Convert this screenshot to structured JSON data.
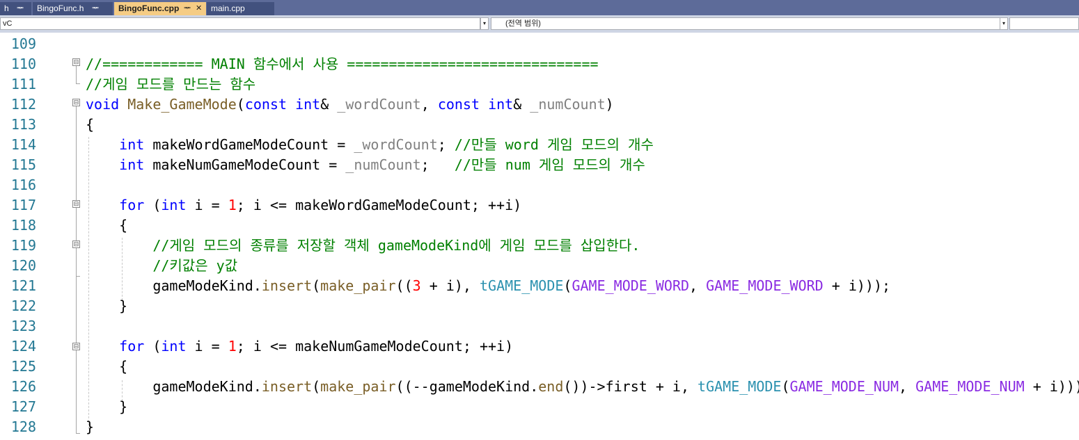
{
  "tabs": [
    {
      "label": "h",
      "pin": "ᆓ"
    },
    {
      "label": "BingoFunc.h",
      "pin": "ᆓ"
    },
    {
      "label": "BingoFunc.cpp",
      "pin": "ᆓ",
      "close": "✕"
    },
    {
      "label": "main.cpp"
    }
  ],
  "nav": {
    "left_combo": "vC",
    "scope_combo": "(전역 범위)",
    "dropdown_arrow": "▾"
  },
  "colors": {
    "keyword": "#0000ff",
    "comment": "#008000",
    "type": "#2b91af",
    "macro": "#8a2be2",
    "function": "#795e26",
    "number": "#ff0000",
    "line_number": "#237893",
    "active_tab": "#f5cc84",
    "tab_strip": "#5d6b99"
  },
  "icons": {
    "fold_minus": "⊟"
  },
  "editor": {
    "lines": [
      {
        "n": "109",
        "segs": []
      },
      {
        "n": "110",
        "segs": [
          {
            "t": "//============ MAIN 함수에서 사용 ==============================",
            "c": "comment"
          }
        ]
      },
      {
        "n": "111",
        "segs": [
          {
            "t": "//게임 모드를 만드는 함수",
            "c": "comment"
          }
        ]
      },
      {
        "n": "112",
        "segs": [
          {
            "t": "void",
            "c": "keyword"
          },
          {
            "t": " ",
            "c": "plain"
          },
          {
            "t": "Make_GameMode",
            "c": "function"
          },
          {
            "t": "(",
            "c": "plain"
          },
          {
            "t": "const",
            "c": "keyword"
          },
          {
            "t": " ",
            "c": "plain"
          },
          {
            "t": "int",
            "c": "keyword"
          },
          {
            "t": "& ",
            "c": "plain"
          },
          {
            "t": "_wordCount",
            "c": "param"
          },
          {
            "t": ", ",
            "c": "plain"
          },
          {
            "t": "const",
            "c": "keyword"
          },
          {
            "t": " ",
            "c": "plain"
          },
          {
            "t": "int",
            "c": "keyword"
          },
          {
            "t": "& ",
            "c": "plain"
          },
          {
            "t": "_numCount",
            "c": "param"
          },
          {
            "t": ")",
            "c": "plain"
          }
        ]
      },
      {
        "n": "113",
        "segs": [
          {
            "t": "{",
            "c": "plain"
          }
        ]
      },
      {
        "n": "114",
        "segs": [
          {
            "t": "    ",
            "c": "plain"
          },
          {
            "t": "int",
            "c": "keyword"
          },
          {
            "t": " makeWordGameModeCount = ",
            "c": "plain"
          },
          {
            "t": "_wordCount",
            "c": "param"
          },
          {
            "t": "; ",
            "c": "plain"
          },
          {
            "t": "//만들 word 게임 모드의 개수",
            "c": "comment"
          }
        ]
      },
      {
        "n": "115",
        "segs": [
          {
            "t": "    ",
            "c": "plain"
          },
          {
            "t": "int",
            "c": "keyword"
          },
          {
            "t": " makeNumGameModeCount = ",
            "c": "plain"
          },
          {
            "t": "_numCount",
            "c": "param"
          },
          {
            "t": ";   ",
            "c": "plain"
          },
          {
            "t": "//만들 num 게임 모드의 개수",
            "c": "comment"
          }
        ]
      },
      {
        "n": "116",
        "segs": []
      },
      {
        "n": "117",
        "segs": [
          {
            "t": "    ",
            "c": "plain"
          },
          {
            "t": "for",
            "c": "keyword"
          },
          {
            "t": " (",
            "c": "plain"
          },
          {
            "t": "int",
            "c": "keyword"
          },
          {
            "t": " i = ",
            "c": "plain"
          },
          {
            "t": "1",
            "c": "number"
          },
          {
            "t": "; i <= makeWordGameModeCount; ++i)",
            "c": "plain"
          }
        ]
      },
      {
        "n": "118",
        "segs": [
          {
            "t": "    {",
            "c": "plain"
          }
        ]
      },
      {
        "n": "119",
        "segs": [
          {
            "t": "        ",
            "c": "plain"
          },
          {
            "t": "//게임 모드의 종류를 저장할 객체 gameModeKind에 게임 모드를 삽입한다.",
            "c": "comment"
          }
        ]
      },
      {
        "n": "120",
        "segs": [
          {
            "t": "        ",
            "c": "plain"
          },
          {
            "t": "//키값은 y값",
            "c": "comment"
          }
        ]
      },
      {
        "n": "121",
        "segs": [
          {
            "t": "        gameModeKind.",
            "c": "plain"
          },
          {
            "t": "insert",
            "c": "function"
          },
          {
            "t": "(",
            "c": "plain"
          },
          {
            "t": "make_pair",
            "c": "function"
          },
          {
            "t": "((",
            "c": "plain"
          },
          {
            "t": "3",
            "c": "number"
          },
          {
            "t": " + i), ",
            "c": "plain"
          },
          {
            "t": "tGAME_MODE",
            "c": "type"
          },
          {
            "t": "(",
            "c": "plain"
          },
          {
            "t": "GAME_MODE_WORD",
            "c": "macro"
          },
          {
            "t": ", ",
            "c": "plain"
          },
          {
            "t": "GAME_MODE_WORD",
            "c": "macro"
          },
          {
            "t": " + i)));",
            "c": "plain"
          }
        ]
      },
      {
        "n": "122",
        "segs": [
          {
            "t": "    }",
            "c": "plain"
          }
        ]
      },
      {
        "n": "123",
        "segs": []
      },
      {
        "n": "124",
        "segs": [
          {
            "t": "    ",
            "c": "plain"
          },
          {
            "t": "for",
            "c": "keyword"
          },
          {
            "t": " (",
            "c": "plain"
          },
          {
            "t": "int",
            "c": "keyword"
          },
          {
            "t": " i = ",
            "c": "plain"
          },
          {
            "t": "1",
            "c": "number"
          },
          {
            "t": "; i <= makeNumGameModeCount; ++i)",
            "c": "plain"
          }
        ]
      },
      {
        "n": "125",
        "segs": [
          {
            "t": "    {",
            "c": "plain"
          }
        ]
      },
      {
        "n": "126",
        "segs": [
          {
            "t": "        gameModeKind.",
            "c": "plain"
          },
          {
            "t": "insert",
            "c": "function"
          },
          {
            "t": "(",
            "c": "plain"
          },
          {
            "t": "make_pair",
            "c": "function"
          },
          {
            "t": "((--gameModeKind.",
            "c": "plain"
          },
          {
            "t": "end",
            "c": "function"
          },
          {
            "t": "())->first + i, ",
            "c": "plain"
          },
          {
            "t": "tGAME_MODE",
            "c": "type"
          },
          {
            "t": "(",
            "c": "plain"
          },
          {
            "t": "GAME_MODE_NUM",
            "c": "macro"
          },
          {
            "t": ", ",
            "c": "plain"
          },
          {
            "t": "GAME_MODE_NUM",
            "c": "macro"
          },
          {
            "t": " + i)));",
            "c": "plain"
          }
        ]
      },
      {
        "n": "127",
        "segs": [
          {
            "t": "    }",
            "c": "plain"
          }
        ]
      },
      {
        "n": "128",
        "segs": [
          {
            "t": "}",
            "c": "plain"
          }
        ]
      }
    ]
  }
}
